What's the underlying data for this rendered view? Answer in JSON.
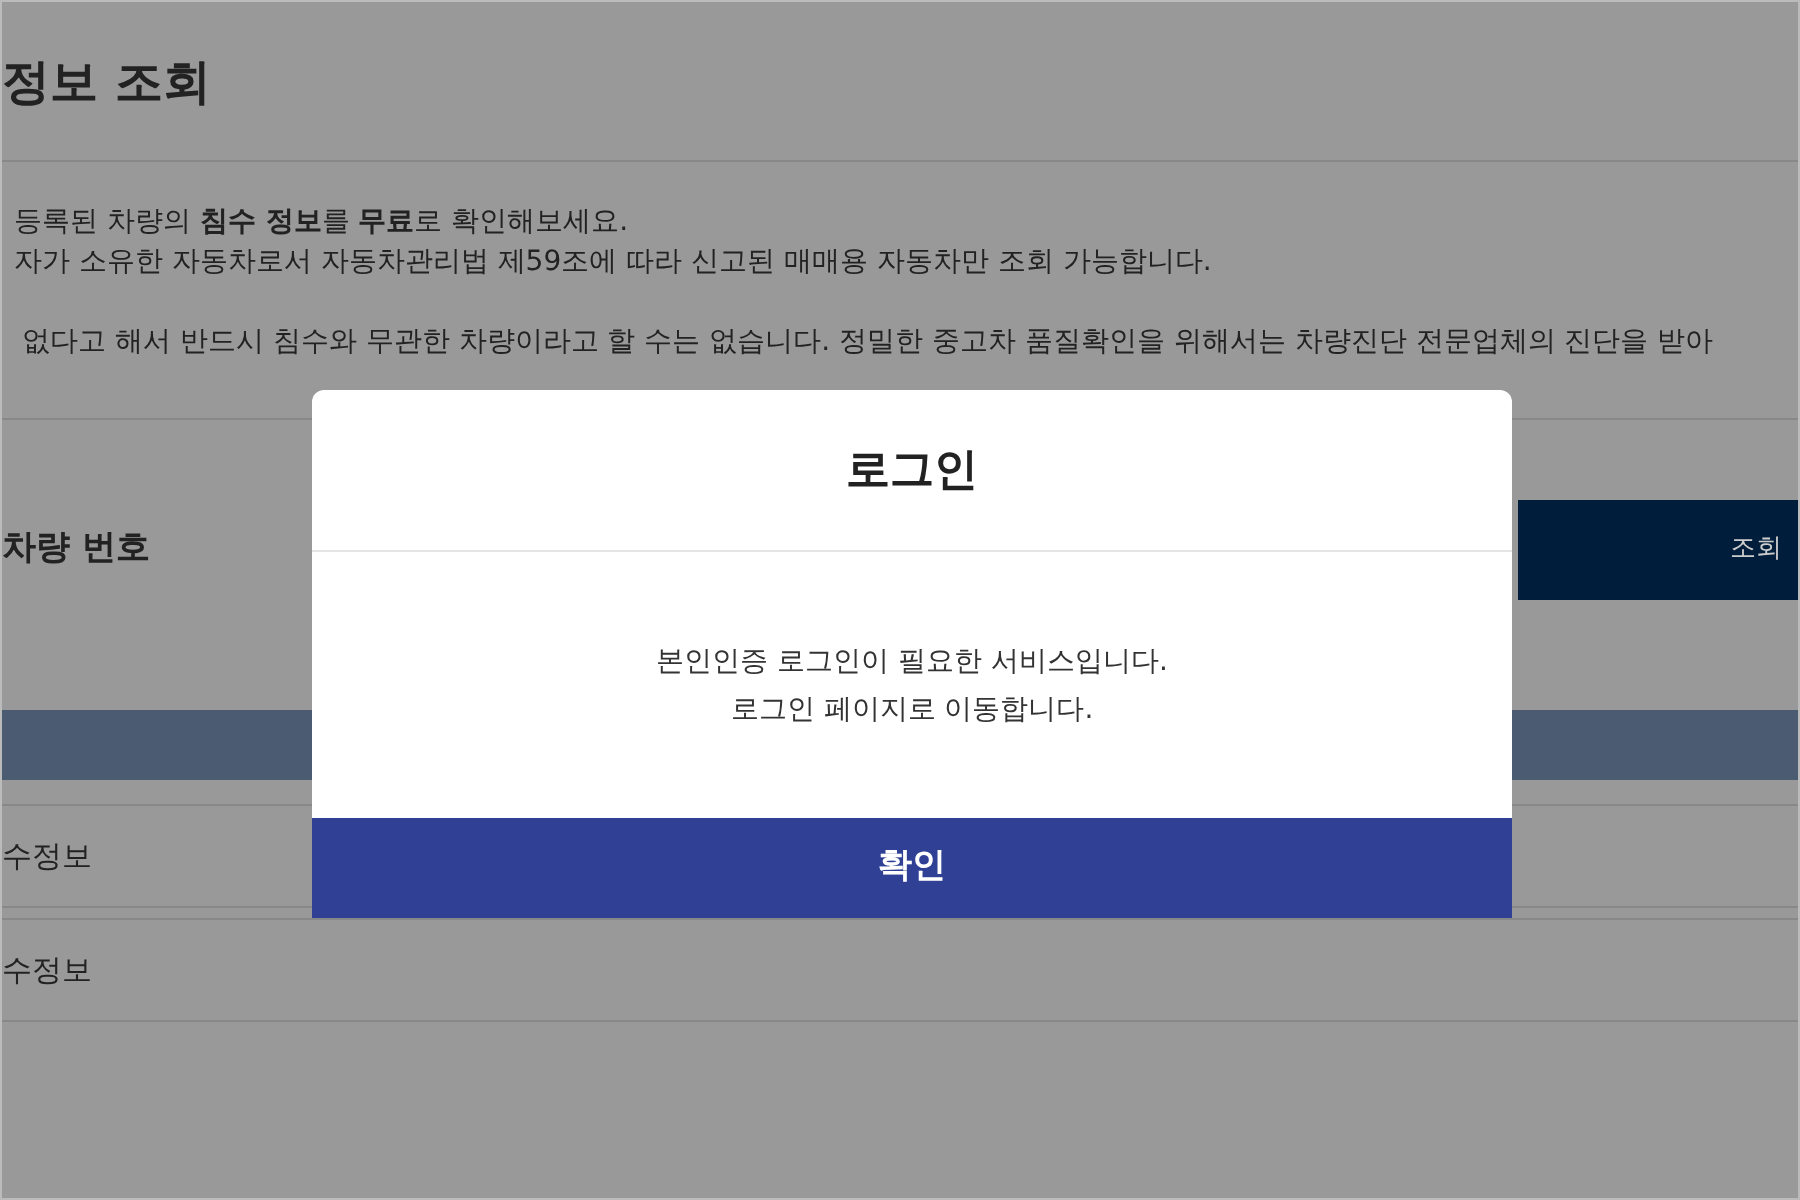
{
  "page": {
    "title": "정보 조회",
    "intro": [
      "등록된 차량의 **침수 정보**를 **무료**로 확인해보세요.",
      "자가 소유한 자동차로서 자동차관리법 제59조에 따라 신고된 매매용 자동차만 조회 가능합니다.",
      "없다고 해서 반드시 침수와 무관한 차량이라고 할 수는 없습니다. 정밀한 중고차 품질확인을 위해서는 차량진단 전문업체의 진단을 받아"
    ],
    "field_label": "차량 번호",
    "search_button": "조회",
    "rows": [
      "수정보",
      "수정보"
    ]
  },
  "dialog": {
    "title": "로그인",
    "message": [
      "본인인증 로그인이 필요한 서비스입니다.",
      "로그인 페이지로 이동합니다."
    ],
    "confirm": "확인"
  }
}
